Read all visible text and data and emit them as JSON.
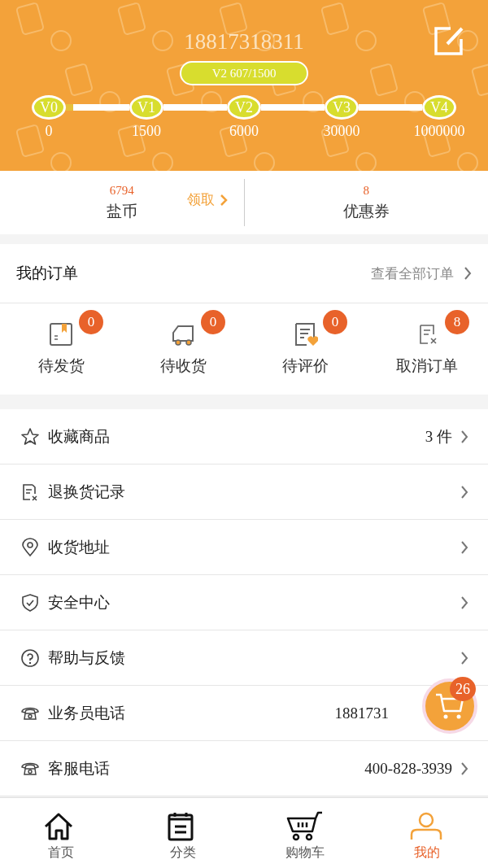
{
  "header": {
    "phone": "18817318311",
    "level_badge": "V2 607/1500",
    "levels": [
      {
        "name": "V0",
        "points": "0",
        "level": 0.12
      },
      {
        "name": "V1",
        "points": "1500"
      },
      {
        "name": "V2",
        "points": "6000"
      },
      {
        "name": "V3",
        "points": "30000"
      },
      {
        "name": "V4",
        "points": "1000000"
      }
    ]
  },
  "assets": {
    "coins": {
      "count": "6794",
      "label": "盐币",
      "action": "领取"
    },
    "coupons": {
      "count": "8",
      "label": "优惠券"
    }
  },
  "orders": {
    "title": "我的订单",
    "link": "查看全部订单",
    "statuses": [
      {
        "kind": "ship",
        "label": "待发货",
        "badge": "0"
      },
      {
        "kind": "receive",
        "label": "待收货",
        "badge": "0"
      },
      {
        "kind": "review",
        "label": "待评价",
        "badge": "0"
      },
      {
        "kind": "cancel",
        "label": "取消订单",
        "badge": "8"
      }
    ]
  },
  "menu": [
    {
      "kind": "star",
      "label": "收藏商品",
      "value": "3 件"
    },
    {
      "kind": "return",
      "label": "退换货记录"
    },
    {
      "kind": "location",
      "label": "收货地址"
    },
    {
      "kind": "shield",
      "label": "安全中心"
    },
    {
      "kind": "help",
      "label": "帮助与反馈"
    },
    {
      "kind": "phone",
      "label": "业务员电话",
      "value": "1881731",
      "chevron": false
    },
    {
      "kind": "phone",
      "label": "客服电话",
      "value": "400-828-3939"
    }
  ],
  "cart_button": {
    "badge": "26"
  },
  "tab_bar": [
    {
      "kind": "home",
      "label": "首页",
      "selected": false
    },
    {
      "kind": "category",
      "label": "分类",
      "selected": false
    },
    {
      "kind": "cart",
      "label": "购物车",
      "selected": false
    },
    {
      "kind": "me",
      "label": "我的",
      "selected": true
    }
  ]
}
